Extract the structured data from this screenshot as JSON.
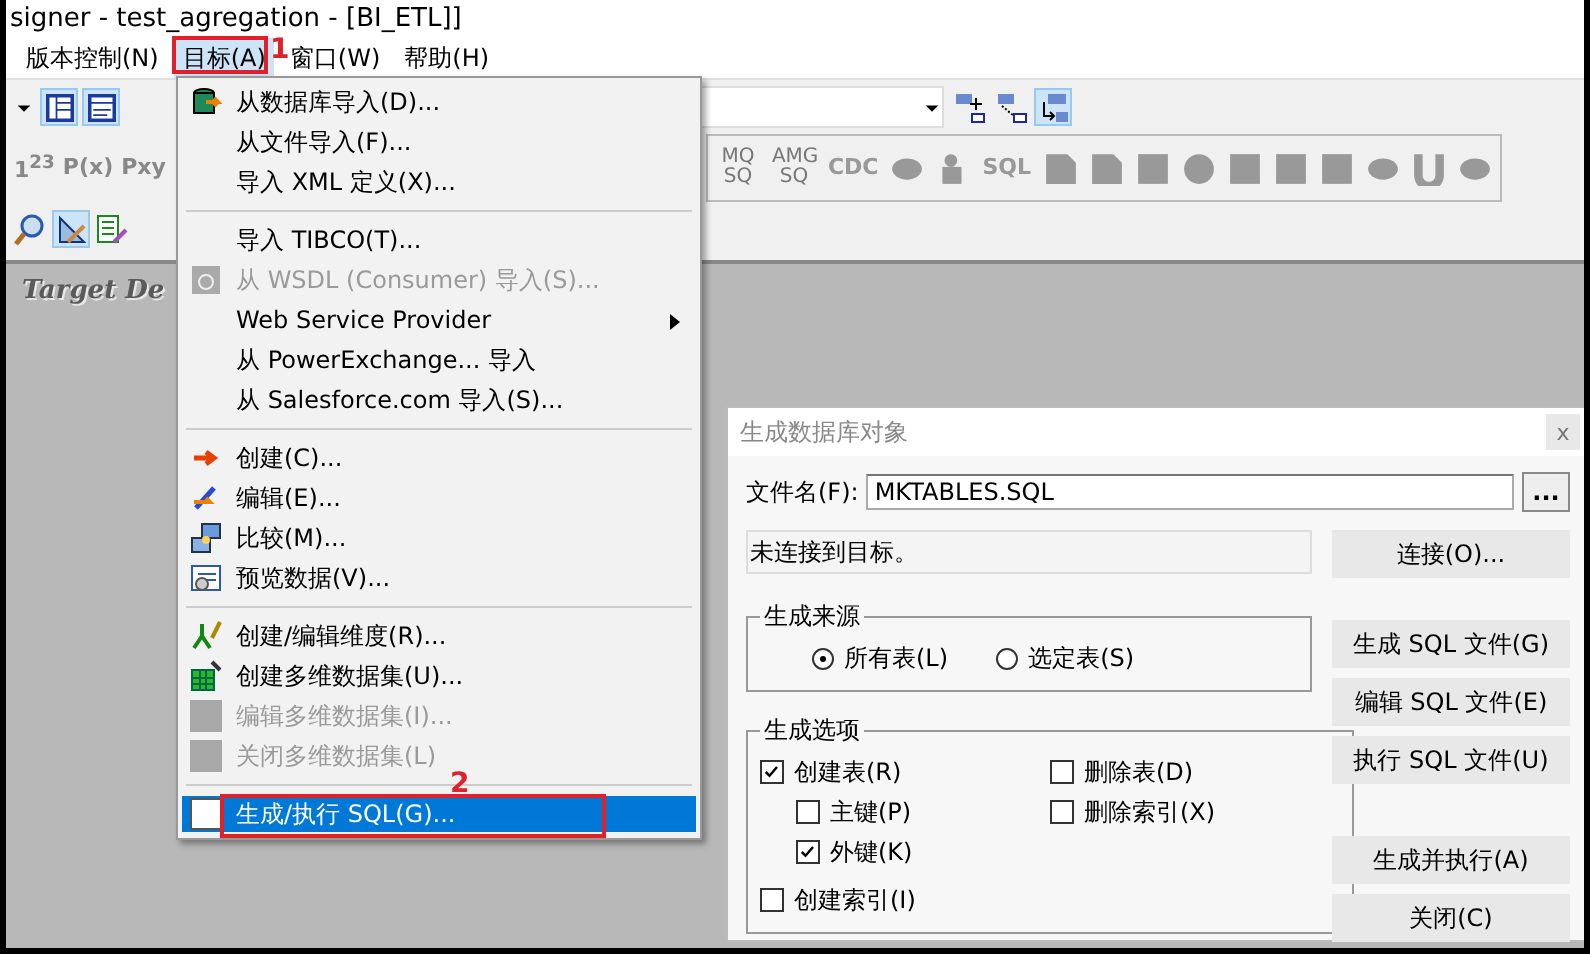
{
  "window": {
    "title": "signer - test_agregation - [BI_ETL]]"
  },
  "menubar": [
    {
      "label": "版本控制(N)",
      "selected": false
    },
    {
      "label": "目标(A)",
      "selected": true
    },
    {
      "label": "窗口(W)",
      "selected": false
    },
    {
      "label": "帮助(H)",
      "selected": false
    }
  ],
  "toolbar_2": {
    "left_items": [
      {
        "kind": "text",
        "label": "1$^{2}$$^{3}$"
      },
      {
        "kind": "text",
        "label": "P(x)"
      },
      {
        "kind": "text",
        "label": "Pxy"
      }
    ],
    "right_items": [
      {
        "kind": "text",
        "label": "MQ SQ"
      },
      {
        "kind": "text",
        "label": "AMG SQ"
      },
      {
        "kind": "text",
        "label": "CDC"
      },
      {
        "kind": "icon"
      },
      {
        "kind": "icon"
      },
      {
        "kind": "text",
        "label": "SQL"
      },
      {
        "kind": "icon"
      },
      {
        "kind": "icon"
      },
      {
        "kind": "icon"
      },
      {
        "kind": "icon"
      },
      {
        "kind": "icon"
      },
      {
        "kind": "icon"
      },
      {
        "kind": "icon"
      },
      {
        "kind": "icon"
      },
      {
        "kind": "icon"
      },
      {
        "kind": "icon"
      }
    ]
  },
  "canvas": {
    "title": "Target De"
  },
  "menu": {
    "items": [
      {
        "kind": "item",
        "label": "从数据库导入(D)...",
        "disabled": false,
        "selected": false,
        "submenu": false
      },
      {
        "kind": "item",
        "label": "从文件导入(F)...",
        "disabled": false,
        "selected": false,
        "submenu": false
      },
      {
        "kind": "item",
        "label": "导入 XML 定义(X)...",
        "disabled": false,
        "selected": false,
        "submenu": false
      },
      {
        "kind": "separator"
      },
      {
        "kind": "item",
        "label": "导入 TIBCO(T)...",
        "disabled": false,
        "selected": false,
        "submenu": false
      },
      {
        "kind": "item",
        "label": "从 WSDL (Consumer) 导入(S)...",
        "disabled": true,
        "selected": false,
        "submenu": false
      },
      {
        "kind": "item",
        "label": "Web Service Provider",
        "disabled": false,
        "selected": false,
        "submenu": true
      },
      {
        "kind": "item",
        "label": "从 PowerExchange... 导入",
        "disabled": false,
        "selected": false,
        "submenu": false
      },
      {
        "kind": "item",
        "label": "从 Salesforce.com 导入(S)...",
        "disabled": false,
        "selected": false,
        "submenu": false
      },
      {
        "kind": "separator"
      },
      {
        "kind": "item",
        "label": "创建(C)...",
        "disabled": false,
        "selected": false,
        "submenu": false
      },
      {
        "kind": "item",
        "label": "编辑(E)...",
        "disabled": false,
        "selected": false,
        "submenu": false
      },
      {
        "kind": "item",
        "label": "比较(M)...",
        "disabled": false,
        "selected": false,
        "submenu": false
      },
      {
        "kind": "item",
        "label": "预览数据(V)...",
        "disabled": false,
        "selected": false,
        "submenu": false
      },
      {
        "kind": "separator"
      },
      {
        "kind": "item",
        "label": "创建/编辑维度(R)...",
        "disabled": false,
        "selected": false,
        "submenu": false
      },
      {
        "kind": "item",
        "label": "创建多维数据集(U)...",
        "disabled": false,
        "selected": false,
        "submenu": false
      },
      {
        "kind": "item",
        "label": "编辑多维数据集(I)...",
        "disabled": true,
        "selected": false,
        "submenu": false
      },
      {
        "kind": "item",
        "label": "关闭多维数据集(L)",
        "disabled": true,
        "selected": false,
        "submenu": false
      },
      {
        "kind": "separator"
      },
      {
        "kind": "item",
        "label": "生成/执行 SQL(G)...",
        "disabled": false,
        "selected": true,
        "submenu": false
      }
    ]
  },
  "dialog": {
    "title": "生成数据库对象",
    "close": "x",
    "file": {
      "label": "文件名(F):",
      "value": "MKTABLES.SQL",
      "browse": "..."
    },
    "status": "未连接到目标。",
    "source": {
      "title": "生成来源",
      "options": [
        {
          "label": "所有表(L)",
          "selected": true
        },
        {
          "label": "选定表(S)",
          "selected": false
        }
      ]
    },
    "options": {
      "title": "生成选项",
      "left": [
        {
          "label": "创建表(R)",
          "checked": true,
          "children": [
            {
              "label": "主键(P)",
              "checked": false
            },
            {
              "label": "外键(K)",
              "checked": true
            }
          ]
        },
        {
          "label": "创建索引(I)",
          "checked": false
        }
      ],
      "right": [
        {
          "label": "删除表(D)",
          "checked": false
        },
        {
          "label": "删除索引(X)",
          "checked": false
        }
      ]
    },
    "button_groups": [
      [
        "连接(O)..."
      ],
      [
        "生成 SQL 文件(G)",
        "编辑 SQL 文件(E)",
        "执行 SQL 文件(U)"
      ],
      [
        "生成并执行(A)",
        "关闭(C)"
      ]
    ]
  },
  "annotations": [
    {
      "label": "1"
    },
    {
      "label": "2"
    }
  ]
}
